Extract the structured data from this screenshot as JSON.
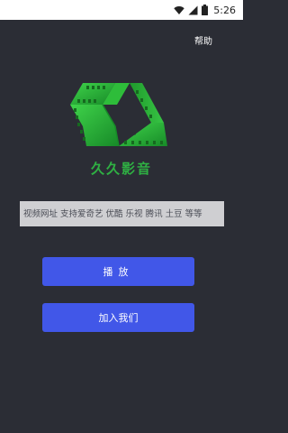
{
  "status_bar": {
    "time": "5:26",
    "icons": [
      "wifi-icon",
      "signal-icon",
      "battery-icon"
    ]
  },
  "header": {
    "help_label": "帮助"
  },
  "branding": {
    "app_name": "久久影音",
    "logo_icon": "film-strip-logo",
    "brand_color": "#2fb043"
  },
  "url_input": {
    "value": "",
    "placeholder": "视频网址 支持爱奇艺 优酷 乐视 腾讯 土豆 等等"
  },
  "actions": {
    "play_label": "播放",
    "join_label": "加入我们",
    "accent_color": "#4157e8"
  },
  "theme": {
    "background": "#2b2d35"
  }
}
